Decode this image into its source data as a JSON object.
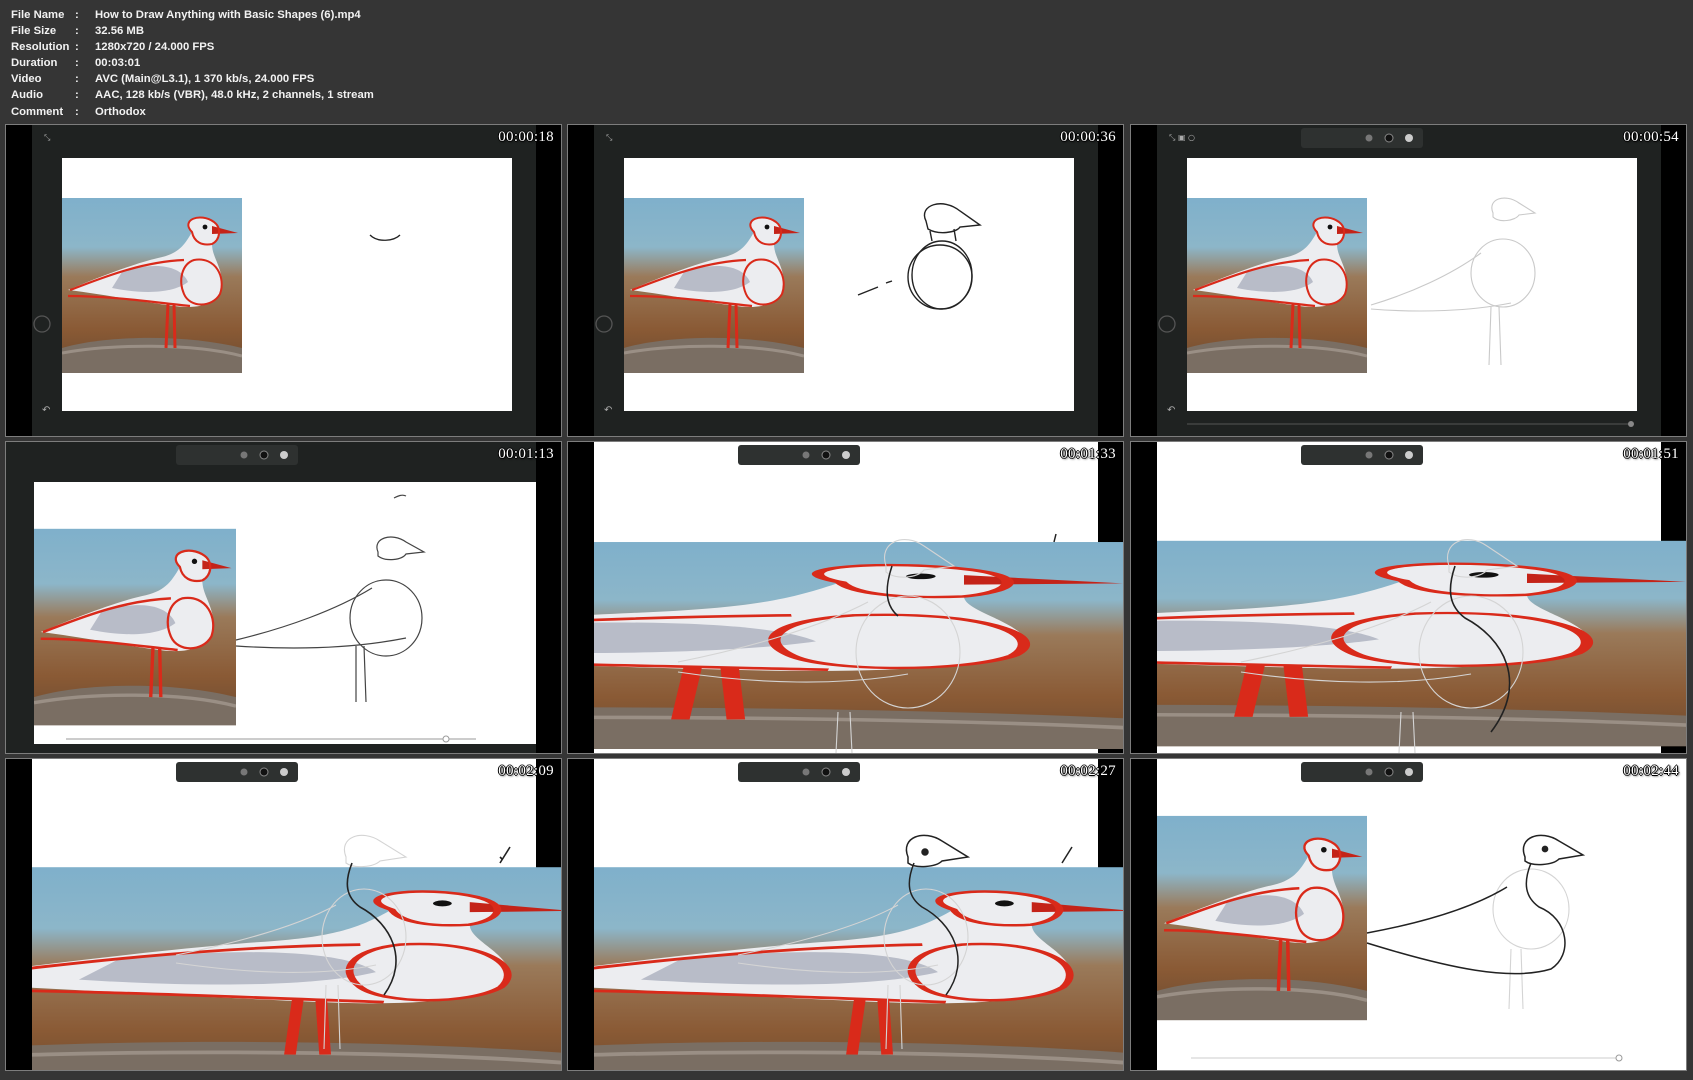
{
  "info": {
    "rows": [
      {
        "label": "File Name",
        "sep": ":",
        "value": "How to Draw Anything with Basic Shapes (6).mp4"
      },
      {
        "label": "File Size",
        "sep": ":",
        "value": "32.56 MB"
      },
      {
        "label": "Resolution",
        "sep": ":",
        "value": "1280x720 / 24.000 FPS"
      },
      {
        "label": "Duration",
        "sep": ":",
        "value": "00:03:01"
      },
      {
        "label": "Video",
        "sep": ":",
        "value": "AVC (Main@L3.1), 1 370 kb/s, 24.000 FPS"
      },
      {
        "label": "Audio",
        "sep": ":",
        "value": "AAC, 128 kb/s (VBR), 48.0 kHz, 2 channels, 1 stream"
      },
      {
        "label": "Comment",
        "sep": ":",
        "value": "Orthodox"
      }
    ]
  },
  "thumbnails": [
    {
      "timestamp": "00:00:18"
    },
    {
      "timestamp": "00:00:36"
    },
    {
      "timestamp": "00:00:54"
    },
    {
      "timestamp": "00:01:13"
    },
    {
      "timestamp": "00:01:33"
    },
    {
      "timestamp": "00:01:51"
    },
    {
      "timestamp": "00:02:09"
    },
    {
      "timestamp": "00:02:27"
    },
    {
      "timestamp": "00:02:44"
    }
  ],
  "colors": {
    "background": "#353535",
    "canvas": "#ffffff",
    "app_dark": "#1f2221",
    "sketch_red": "#d92a1a"
  }
}
